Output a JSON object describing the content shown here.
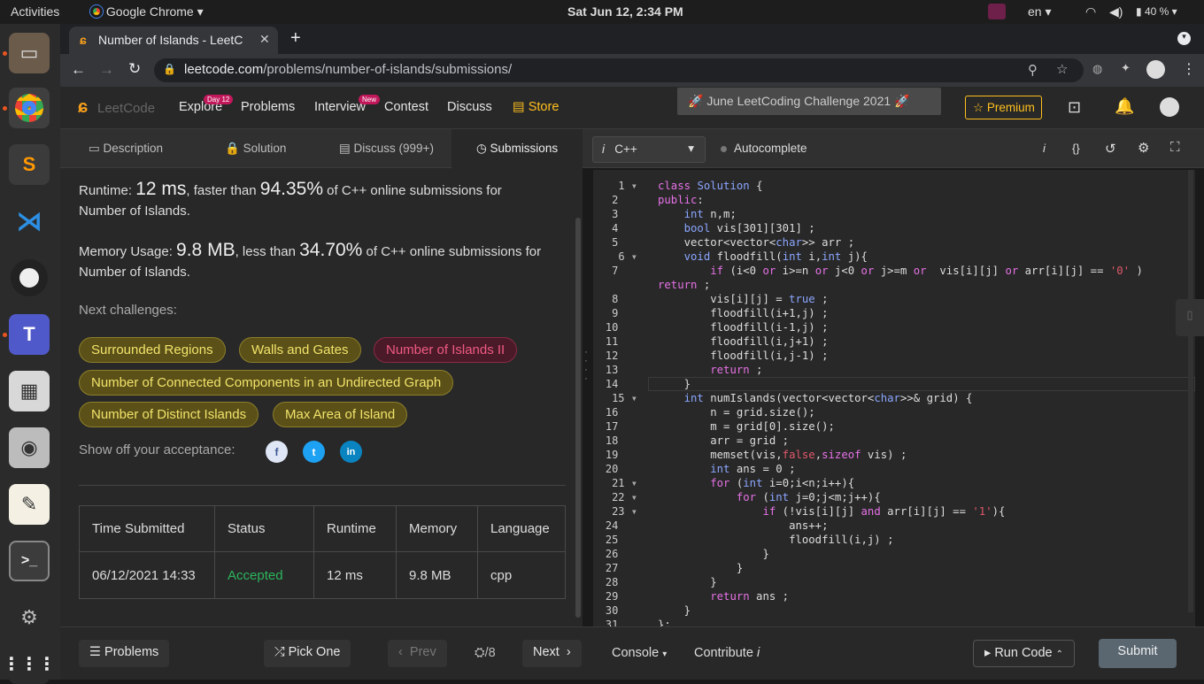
{
  "os": {
    "activities": "Activities",
    "app_name": "Google Chrome",
    "clock": "Sat Jun 12,  2:34 PM",
    "lang": "en",
    "battery": "40 %"
  },
  "browser": {
    "tab_title": "Number of Islands - LeetC",
    "url_host": "leetcode.com",
    "url_path": "/problems/number-of-islands/submissions/"
  },
  "lc_nav": {
    "logo": "LeetCode",
    "explore": "Explore",
    "explore_badge": "Day 12",
    "problems": "Problems",
    "interview": "Interview",
    "interview_badge": "New",
    "contest": "Contest",
    "discuss": "Discuss",
    "store": "Store",
    "challenge": "June LeetCoding Challenge 2021",
    "premium": "Premium"
  },
  "left_tabs": {
    "description": "Description",
    "solution": "Solution",
    "discuss": "Discuss (999+)",
    "submissions": "Submissions"
  },
  "result": {
    "runtime_label": "Runtime: ",
    "runtime_value": "12 ms",
    "runtime_mid": ", faster than ",
    "runtime_pct": "94.35%",
    "runtime_tail": " of C++ online submissions for",
    "runtime_tail2": "Number of Islands.",
    "memory_label": "Memory Usage: ",
    "memory_value": "9.8 MB",
    "memory_mid": ", less than ",
    "memory_pct": "34.70%",
    "memory_tail": " of C++ online submissions for",
    "memory_tail2": "Number of Islands.",
    "next_label": "Next challenges:",
    "share_label": "Show off your acceptance:"
  },
  "challenges": [
    "Surrounded Regions",
    "Walls and Gates",
    "Number of Islands II",
    "Number of Connected Components in an Undirected Graph",
    "Number of Distinct Islands",
    "Max Area of Island"
  ],
  "table": {
    "headers": [
      "Time Submitted",
      "Status",
      "Runtime",
      "Memory",
      "Language"
    ],
    "row": [
      "06/12/2021 14:33",
      "Accepted",
      "12 ms",
      "9.8 MB",
      "cpp"
    ]
  },
  "editor": {
    "language": "C++",
    "autocomplete": "Autocomplete"
  },
  "bottom": {
    "problems": "Problems",
    "pick_one": "Pick One",
    "prev": "Prev",
    "counter": "/8",
    "next": "Next",
    "console": "Console",
    "contribute": "Contribute",
    "run_code": "Run Code",
    "submit": "Submit"
  },
  "colors": {
    "accept_green": "#2db55d",
    "chip_yellow": "#f2e36a",
    "chip_red": "#ef5a83",
    "premium_gold": "#ffc01e"
  }
}
